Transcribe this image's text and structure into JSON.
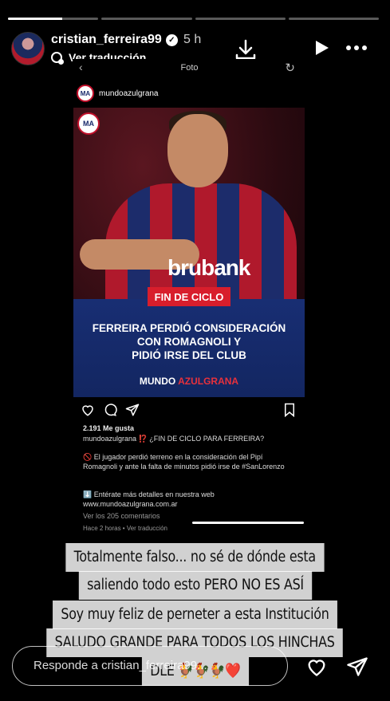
{
  "story": {
    "segments": [
      1,
      0,
      0,
      0
    ],
    "username": "cristian_ferreira99",
    "time": "5 h",
    "translate": "Ver traducción"
  },
  "post": {
    "screen_title": "Foto",
    "account": "mundoazulgrana",
    "logo_text": "MA",
    "brand": "brubank",
    "tag": "FIN DE CICLO",
    "headline": [
      "FERREIRA PERDIÓ CONSIDERACIÓN",
      "CON ROMAGNOLI Y",
      "PIDIÓ IRSE DEL CLUB"
    ],
    "mundo": "MUNDO",
    "azulgrana": "AZULGRANA",
    "likes": "2.191 Me gusta",
    "caption": "mundoazulgrana ⁉️ ¿FIN DE CICLO PARA FERREIRA?",
    "body1": "🚫 El jugador perdió terreno en la consideración del Pipí Romagnoli y ante la falta de minutos pidió irse de #SanLorenzo",
    "body2": "⬇️ Entérate más detalles en nuestra web",
    "body3": "www.mundoazulgrana.com.ar",
    "comments": "Ver los 205 comentarios",
    "meta": "Hace 2 horas • Ver traducción"
  },
  "stickers": [
    "Totalmente falso... no sé de dónde esta",
    "saliendo todo esto PERO NO ES ASÍ",
    "Soy muy feliz de perneter a esta Institución",
    "SALUDO GRANDE PARA TODOS LOS HINCHAS",
    "DLE 🐓🐓🐓❤️"
  ],
  "reply": {
    "placeholder": "Responde a cristian_ferreira99..."
  }
}
